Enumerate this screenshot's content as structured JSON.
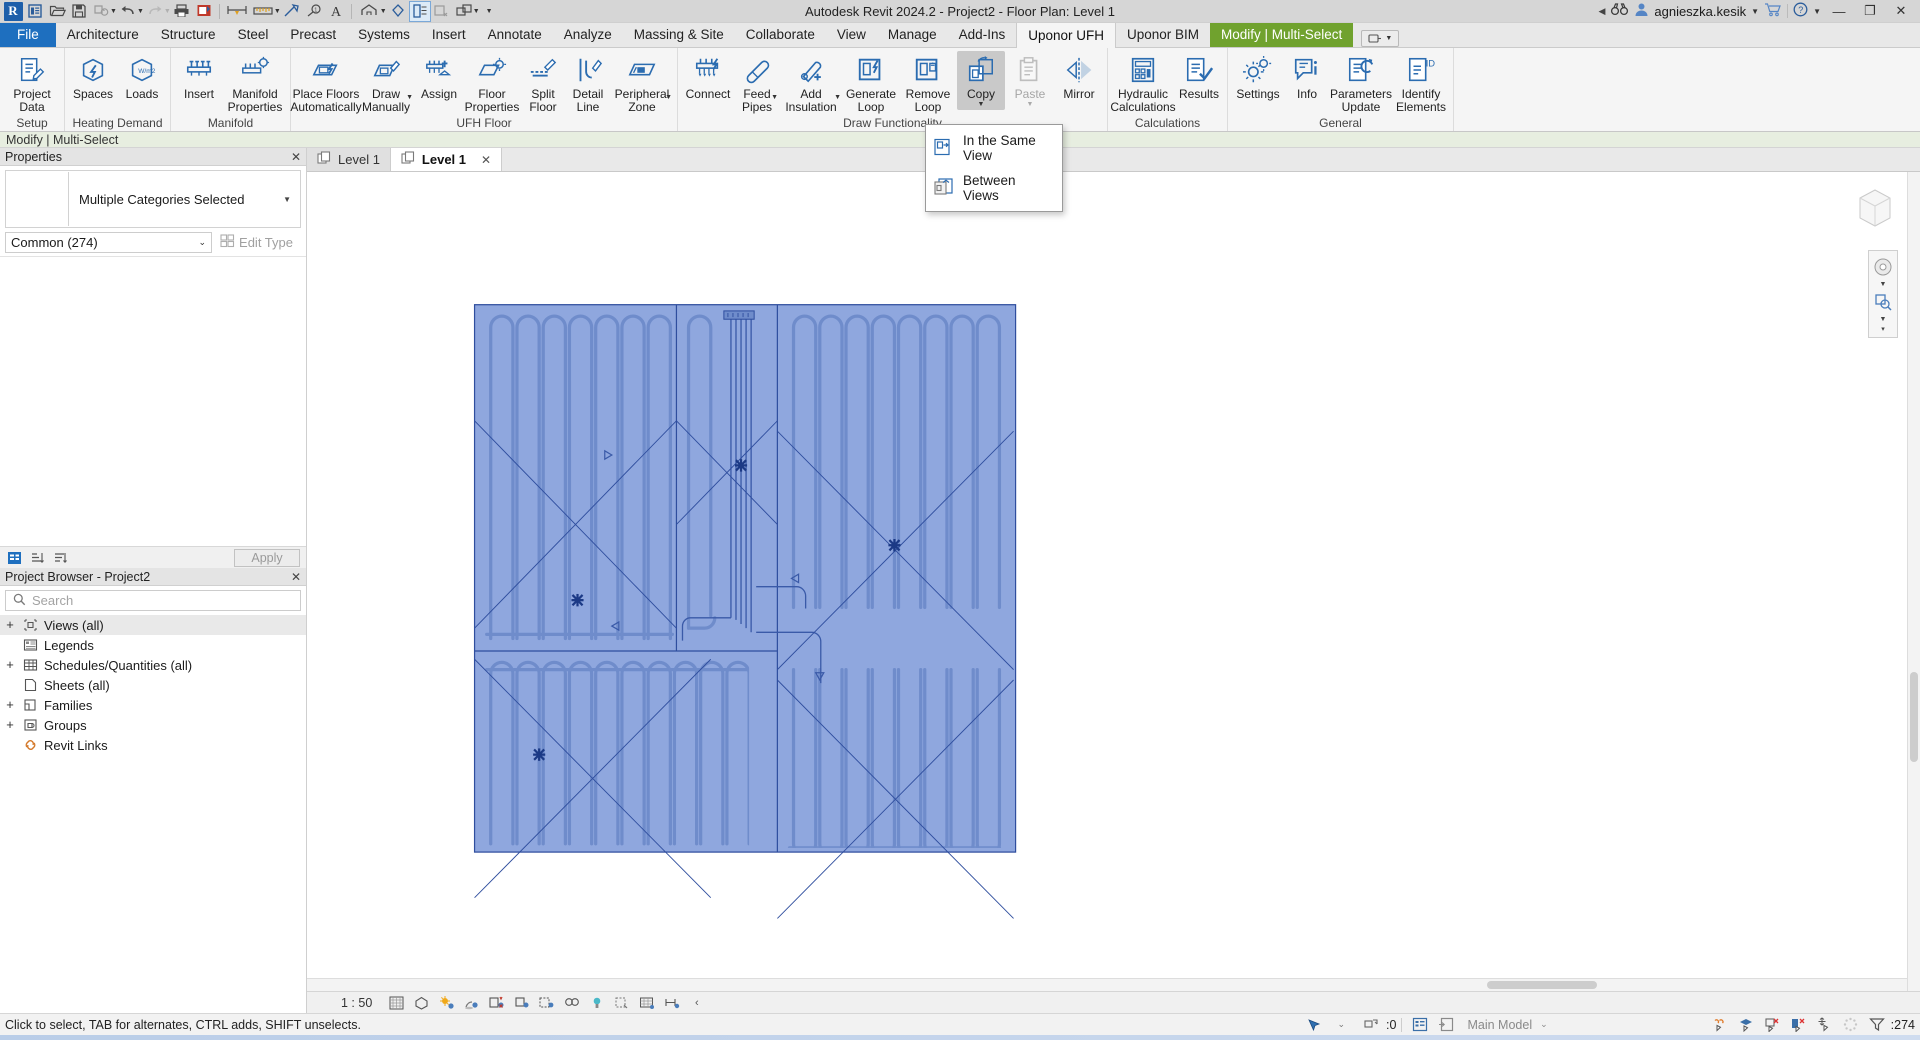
{
  "window": {
    "title": "Autodesk Revit 2024.2 - Project2 - Floor Plan: Level 1",
    "username": "agnieszka.kesik",
    "minimize_label": "—",
    "restore_label": "❐",
    "close_label": "✕"
  },
  "quick_access": {
    "logo": "R",
    "items": [
      {
        "name": "project-info-icon",
        "label": "Project Information"
      },
      {
        "name": "open-icon",
        "label": "Open"
      },
      {
        "name": "save-icon",
        "label": "Save"
      },
      {
        "name": "sync-icon",
        "label": "Synchronize with Central"
      },
      {
        "name": "undo-icon",
        "label": "Undo"
      },
      {
        "name": "redo-icon",
        "label": "Redo"
      },
      {
        "name": "print-icon",
        "label": "Print"
      },
      {
        "name": "measure-icon",
        "label": "Measure"
      },
      {
        "name": "aligned-dimension-icon",
        "label": "Aligned Dimension"
      },
      {
        "name": "tag-icon",
        "label": "Tag by Category"
      },
      {
        "name": "text-icon",
        "label": "Text"
      },
      {
        "name": "default-3d-view-icon",
        "label": "Default 3D View"
      },
      {
        "name": "section-icon",
        "label": "Section"
      },
      {
        "name": "thin-lines-icon",
        "label": "Thin Lines"
      },
      {
        "name": "close-hidden-windows-icon",
        "label": "Close Hidden Windows"
      },
      {
        "name": "switch-windows-icon",
        "label": "Switch Windows"
      },
      {
        "name": "customize-qat-icon",
        "label": "Customize Quick Access Toolbar"
      }
    ]
  },
  "ribbon_tabs": [
    {
      "label": "File",
      "state": "file"
    },
    {
      "label": "Architecture",
      "state": "normal"
    },
    {
      "label": "Structure",
      "state": "normal"
    },
    {
      "label": "Steel",
      "state": "normal"
    },
    {
      "label": "Precast",
      "state": "normal"
    },
    {
      "label": "Systems",
      "state": "normal"
    },
    {
      "label": "Insert",
      "state": "normal"
    },
    {
      "label": "Annotate",
      "state": "normal"
    },
    {
      "label": "Analyze",
      "state": "normal"
    },
    {
      "label": "Massing & Site",
      "state": "normal"
    },
    {
      "label": "Collaborate",
      "state": "normal"
    },
    {
      "label": "View",
      "state": "normal"
    },
    {
      "label": "Manage",
      "state": "normal"
    },
    {
      "label": "Add-Ins",
      "state": "normal"
    },
    {
      "label": "Uponor UFH",
      "state": "active"
    },
    {
      "label": "Uponor BIM",
      "state": "normal"
    },
    {
      "label": "Modify | Multi-Select",
      "state": "context"
    }
  ],
  "context_strip": {
    "label": "Modify | Multi-Select"
  },
  "ribbon_panels": [
    {
      "title": "Setup",
      "buttons": [
        {
          "label": "Project\nData",
          "icon": "project-data-icon",
          "name": "project-data-button",
          "arrow": false,
          "state": "normal",
          "width": "w56"
        }
      ]
    },
    {
      "title": "Heating Demand",
      "buttons": [
        {
          "label": "Spaces",
          "icon": "spaces-icon",
          "name": "spaces-button",
          "arrow": false,
          "state": "normal",
          "width": "w48"
        },
        {
          "label": "Loads",
          "icon": "loads-icon",
          "name": "loads-button",
          "arrow": false,
          "state": "normal",
          "width": "w48"
        }
      ]
    },
    {
      "title": "Manifold",
      "buttons": [
        {
          "label": "Insert",
          "icon": "manifold-insert-icon",
          "name": "insert-manifold-button",
          "arrow": false,
          "state": "normal",
          "width": "w48"
        },
        {
          "label": "Manifold\nProperties",
          "icon": "manifold-properties-icon",
          "name": "manifold-properties-button",
          "arrow": false,
          "state": "normal",
          "width": "w62"
        }
      ]
    },
    {
      "title": "UFH Floor",
      "buttons": [
        {
          "label": "Place Floors\nAutomatically",
          "icon": "place-floors-icon",
          "name": "place-floors-automatically-button",
          "arrow": false,
          "state": "normal",
          "width": "w62"
        },
        {
          "label": "Draw\nManually",
          "icon": "draw-manually-icon",
          "name": "draw-manually-button",
          "arrow": true,
          "state": "normal",
          "width": "w56"
        },
        {
          "label": "Assign",
          "icon": "assign-icon",
          "name": "assign-button",
          "arrow": false,
          "state": "normal",
          "width": "w48"
        },
        {
          "label": "Floor\nProperties",
          "icon": "floor-properties-icon",
          "name": "floor-properties-button",
          "arrow": false,
          "state": "normal",
          "width": "w56"
        },
        {
          "label": "Split\nFloor",
          "icon": "split-floor-icon",
          "name": "split-floor-button",
          "arrow": false,
          "state": "normal",
          "width": "w44"
        },
        {
          "label": "Detail\nLine",
          "icon": "detail-line-icon",
          "name": "detail-line-button",
          "arrow": false,
          "state": "normal",
          "width": "w44"
        },
        {
          "label": "Peripheral\nZone",
          "icon": "peripheral-zone-icon",
          "name": "peripheral-zone-button",
          "arrow": true,
          "state": "normal",
          "width": "w62"
        }
      ]
    },
    {
      "title": "Draw Functionality",
      "buttons": [
        {
          "label": "Connect",
          "icon": "connect-icon",
          "name": "connect-button",
          "arrow": false,
          "state": "normal",
          "width": "w52"
        },
        {
          "label": "Feed\nPipes",
          "icon": "feed-pipes-icon",
          "name": "feed-pipes-button",
          "arrow": true,
          "state": "normal",
          "width": "w44"
        },
        {
          "label": "Add\nInsulation",
          "icon": "add-insulation-icon",
          "name": "add-insulation-button",
          "arrow": true,
          "state": "normal",
          "width": "w62"
        },
        {
          "label": "Generate\nLoop",
          "icon": "generate-loop-icon",
          "name": "generate-loop-button",
          "arrow": false,
          "state": "normal",
          "width": "w56"
        },
        {
          "label": "Remove\nLoop",
          "icon": "remove-loop-icon",
          "name": "remove-loop-button",
          "arrow": false,
          "state": "normal",
          "width": "w56"
        },
        {
          "label": "Copy",
          "icon": "copy-icon",
          "name": "copy-button",
          "arrow": true,
          "state": "pressed",
          "width": "w48"
        },
        {
          "label": "Paste",
          "icon": "paste-icon",
          "name": "paste-button",
          "arrow": true,
          "state": "disabled",
          "width": "w48"
        },
        {
          "label": "Mirror",
          "icon": "mirror-icon",
          "name": "mirror-button",
          "arrow": false,
          "state": "normal",
          "width": "w48"
        }
      ]
    },
    {
      "title": "Calculations",
      "buttons": [
        {
          "label": "Hydraulic\nCalculations",
          "icon": "hydraulic-calculations-icon",
          "name": "hydraulic-calculations-button",
          "arrow": false,
          "state": "normal",
          "width": "w62"
        },
        {
          "label": "Results",
          "icon": "results-icon",
          "name": "results-button",
          "arrow": false,
          "state": "normal",
          "width": "w48"
        }
      ]
    },
    {
      "title": "General",
      "buttons": [
        {
          "label": "Settings",
          "icon": "settings-icon",
          "name": "settings-button",
          "arrow": false,
          "state": "normal",
          "width": "w52"
        },
        {
          "label": "Info",
          "icon": "info-icon",
          "name": "info-button",
          "arrow": false,
          "state": "normal",
          "width": "w44"
        },
        {
          "label": "Parameters\nUpdate",
          "icon": "parameters-update-icon",
          "name": "parameters-update-button",
          "arrow": false,
          "state": "normal",
          "width": "w62"
        },
        {
          "label": "Identify\nElements",
          "icon": "identify-elements-icon",
          "name": "identify-elements-button",
          "arrow": false,
          "state": "normal",
          "width": "w56"
        }
      ]
    }
  ],
  "copy_menu": {
    "items": [
      {
        "label": "In the Same View",
        "icon": "copy-same-view-icon",
        "name": "copy-in-the-same-view-item"
      },
      {
        "label": "Between Views",
        "icon": "copy-between-views-icon",
        "name": "copy-between-views-item"
      }
    ]
  },
  "properties": {
    "title": "Properties",
    "close": "✕",
    "type_name": "Multiple Categories Selected",
    "type_arrow": "▼",
    "filter_value": "Common (274)",
    "filter_arrow": "⌄",
    "edit_type_label": "Edit Type",
    "apply_label": "Apply",
    "footer_icons": [
      "properties-help-icon",
      "sort-ascending-icon",
      "sort-descending-icon"
    ]
  },
  "browser": {
    "title": "Project Browser - Project2",
    "close": "✕",
    "search_placeholder": "Search",
    "nodes": [
      {
        "label": "Views (all)",
        "expander": "+",
        "icon": "views-icon",
        "selected": true
      },
      {
        "label": "Legends",
        "expander": "",
        "icon": "legends-icon",
        "selected": false
      },
      {
        "label": "Schedules/Quantities (all)",
        "expander": "+",
        "icon": "schedules-icon",
        "selected": false
      },
      {
        "label": "Sheets (all)",
        "expander": "",
        "icon": "sheets-icon",
        "selected": false
      },
      {
        "label": "Families",
        "expander": "+",
        "icon": "families-icon",
        "selected": false
      },
      {
        "label": "Groups",
        "expander": "+",
        "icon": "groups-icon",
        "selected": false
      },
      {
        "label": "Revit Links",
        "expander": "",
        "icon": "revit-links-icon",
        "selected": false
      }
    ]
  },
  "view_tabs": [
    {
      "label": "Level 1",
      "active": false,
      "closable": false
    },
    {
      "label": "Level 1",
      "active": true,
      "closable": true,
      "close": "✕"
    }
  ],
  "view_control": {
    "scale": "1 : 50",
    "icons": [
      "detail-level-icon",
      "visual-style-icon",
      "sun-path-icon",
      "shadows-icon",
      "rendering-dialog-icon",
      "crop-view-icon",
      "show-crop-region-icon",
      "lock-3d-view-icon",
      "temporary-hide-isolate-icon",
      "reveal-hidden-icon",
      "analytical-model-icon",
      "constraints-icon",
      "expand-icon"
    ]
  },
  "status_bar": {
    "message": "Click to select, TAB for alternates, CTRL adds, SHIFT unselects.",
    "worksets_count": ":0",
    "model_label": "Main Model",
    "filter_count": ":274",
    "left_icon": "press-drag-icon",
    "right_icons": [
      "select-links-icon",
      "select-underlay-icon",
      "select-pinned-icon",
      "select-face-icon",
      "drag-element-icon",
      "loading-icon",
      "filter-icon"
    ]
  },
  "floor_plan": {
    "fill_color": "#8fa7de",
    "line_color": "#2f4e9e",
    "zones": [
      {
        "name": "upper-left-zone",
        "loops": 7,
        "orientation": "vertical"
      },
      {
        "name": "upper-right-zone",
        "loops": 9,
        "orientation": "vertical"
      },
      {
        "name": "lower-left-zone",
        "loops": 10,
        "orientation": "vertical"
      },
      {
        "name": "corridor-zone",
        "loops": 1,
        "orientation": "vertical"
      }
    ],
    "manifold_label": "manifold",
    "selection_markers": 4
  }
}
